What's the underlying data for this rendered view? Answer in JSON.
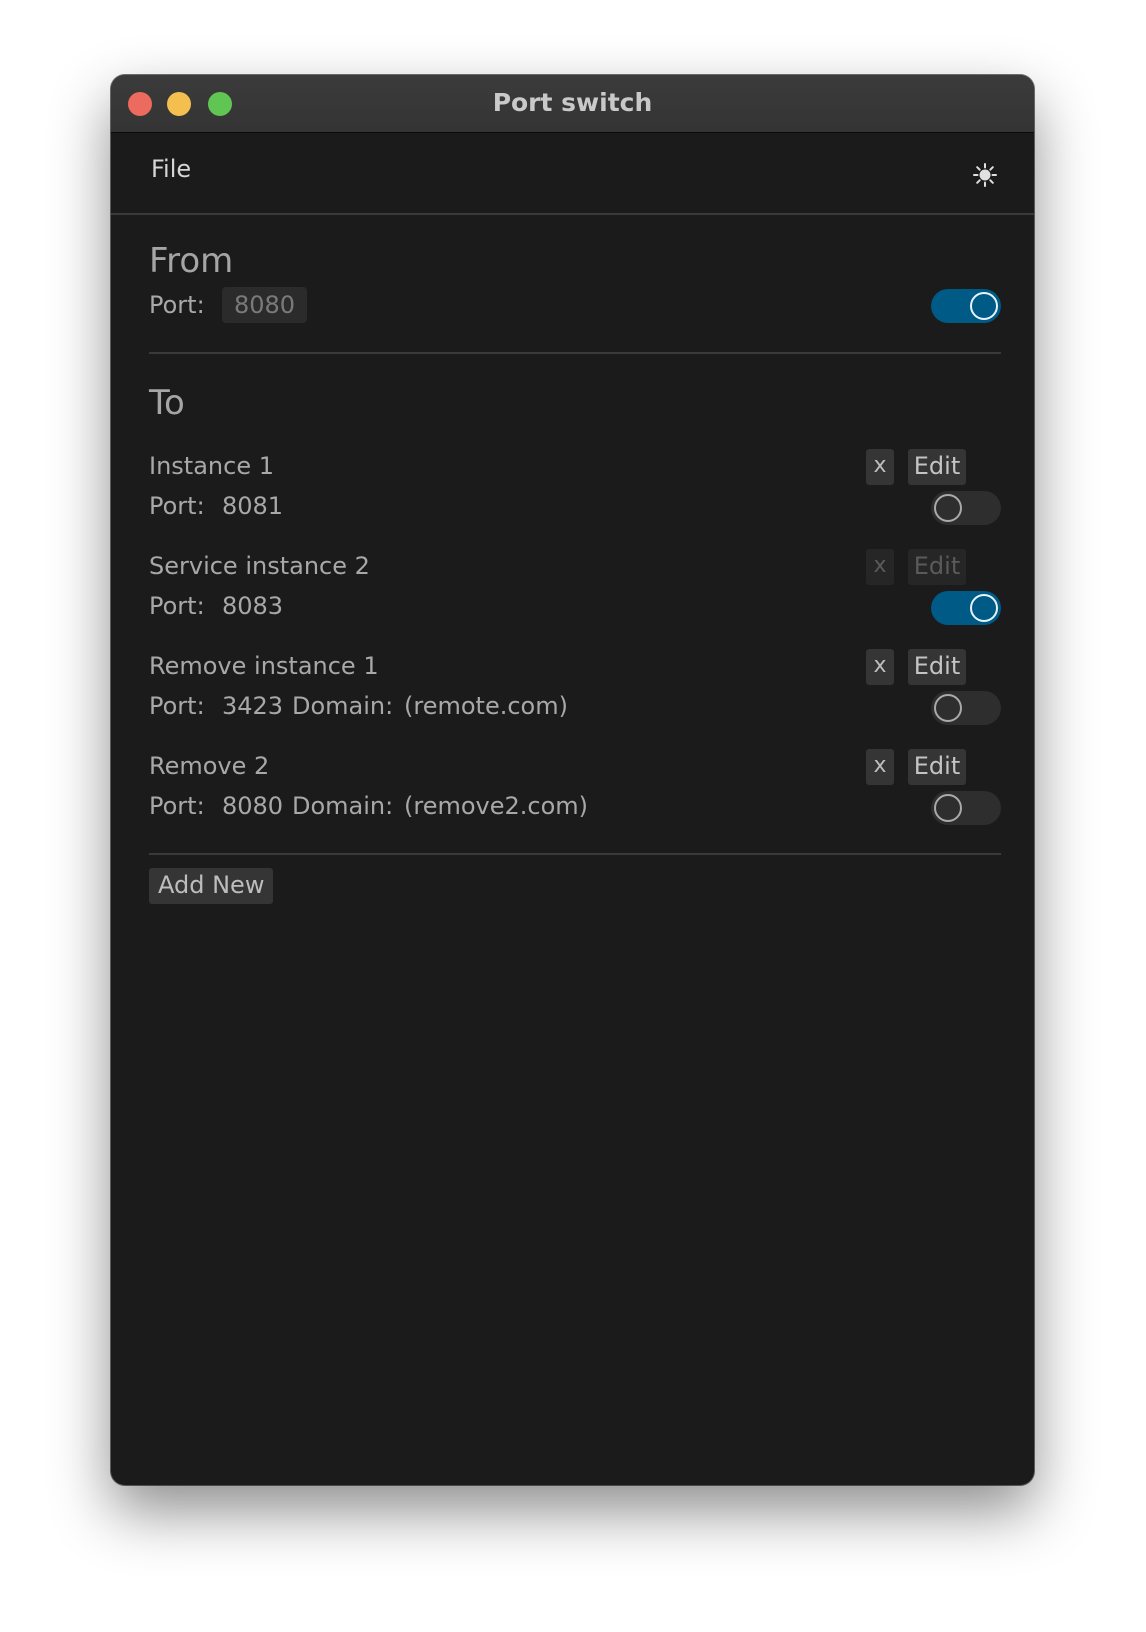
{
  "window": {
    "title": "Port switch"
  },
  "menu": {
    "file_label": "File",
    "theme_icon": "sun-icon"
  },
  "from": {
    "heading": "From",
    "port_label": "Port:",
    "port_value": "8080",
    "enabled": true
  },
  "to": {
    "heading": "To",
    "instances": [
      {
        "name": "Instance 1",
        "port_label": "Port:",
        "port": "8081",
        "domain_label": "",
        "domain": "",
        "enabled": false,
        "remove_label": "x",
        "edit_label": "Edit",
        "actions_disabled": false
      },
      {
        "name": "Service instance 2",
        "port_label": "Port:",
        "port": "8083",
        "domain_label": "",
        "domain": "",
        "enabled": true,
        "remove_label": "x",
        "edit_label": "Edit",
        "actions_disabled": true
      },
      {
        "name": "Remove instance 1",
        "port_label": "Port:",
        "port": "3423",
        "domain_label": "Domain:",
        "domain": "(remote.com)",
        "enabled": false,
        "remove_label": "x",
        "edit_label": "Edit",
        "actions_disabled": false
      },
      {
        "name": "Remove 2",
        "port_label": "Port:",
        "port": "8080",
        "domain_label": "Domain:",
        "domain": "(remove2.com)",
        "enabled": false,
        "remove_label": "x",
        "edit_label": "Edit",
        "actions_disabled": false
      }
    ]
  },
  "add_new_label": "Add New",
  "colors": {
    "accent": "#005a86",
    "background": "#1b1b1b",
    "close": "#ed6a5e",
    "minimize": "#f5bf4f",
    "maximize": "#61c554"
  }
}
